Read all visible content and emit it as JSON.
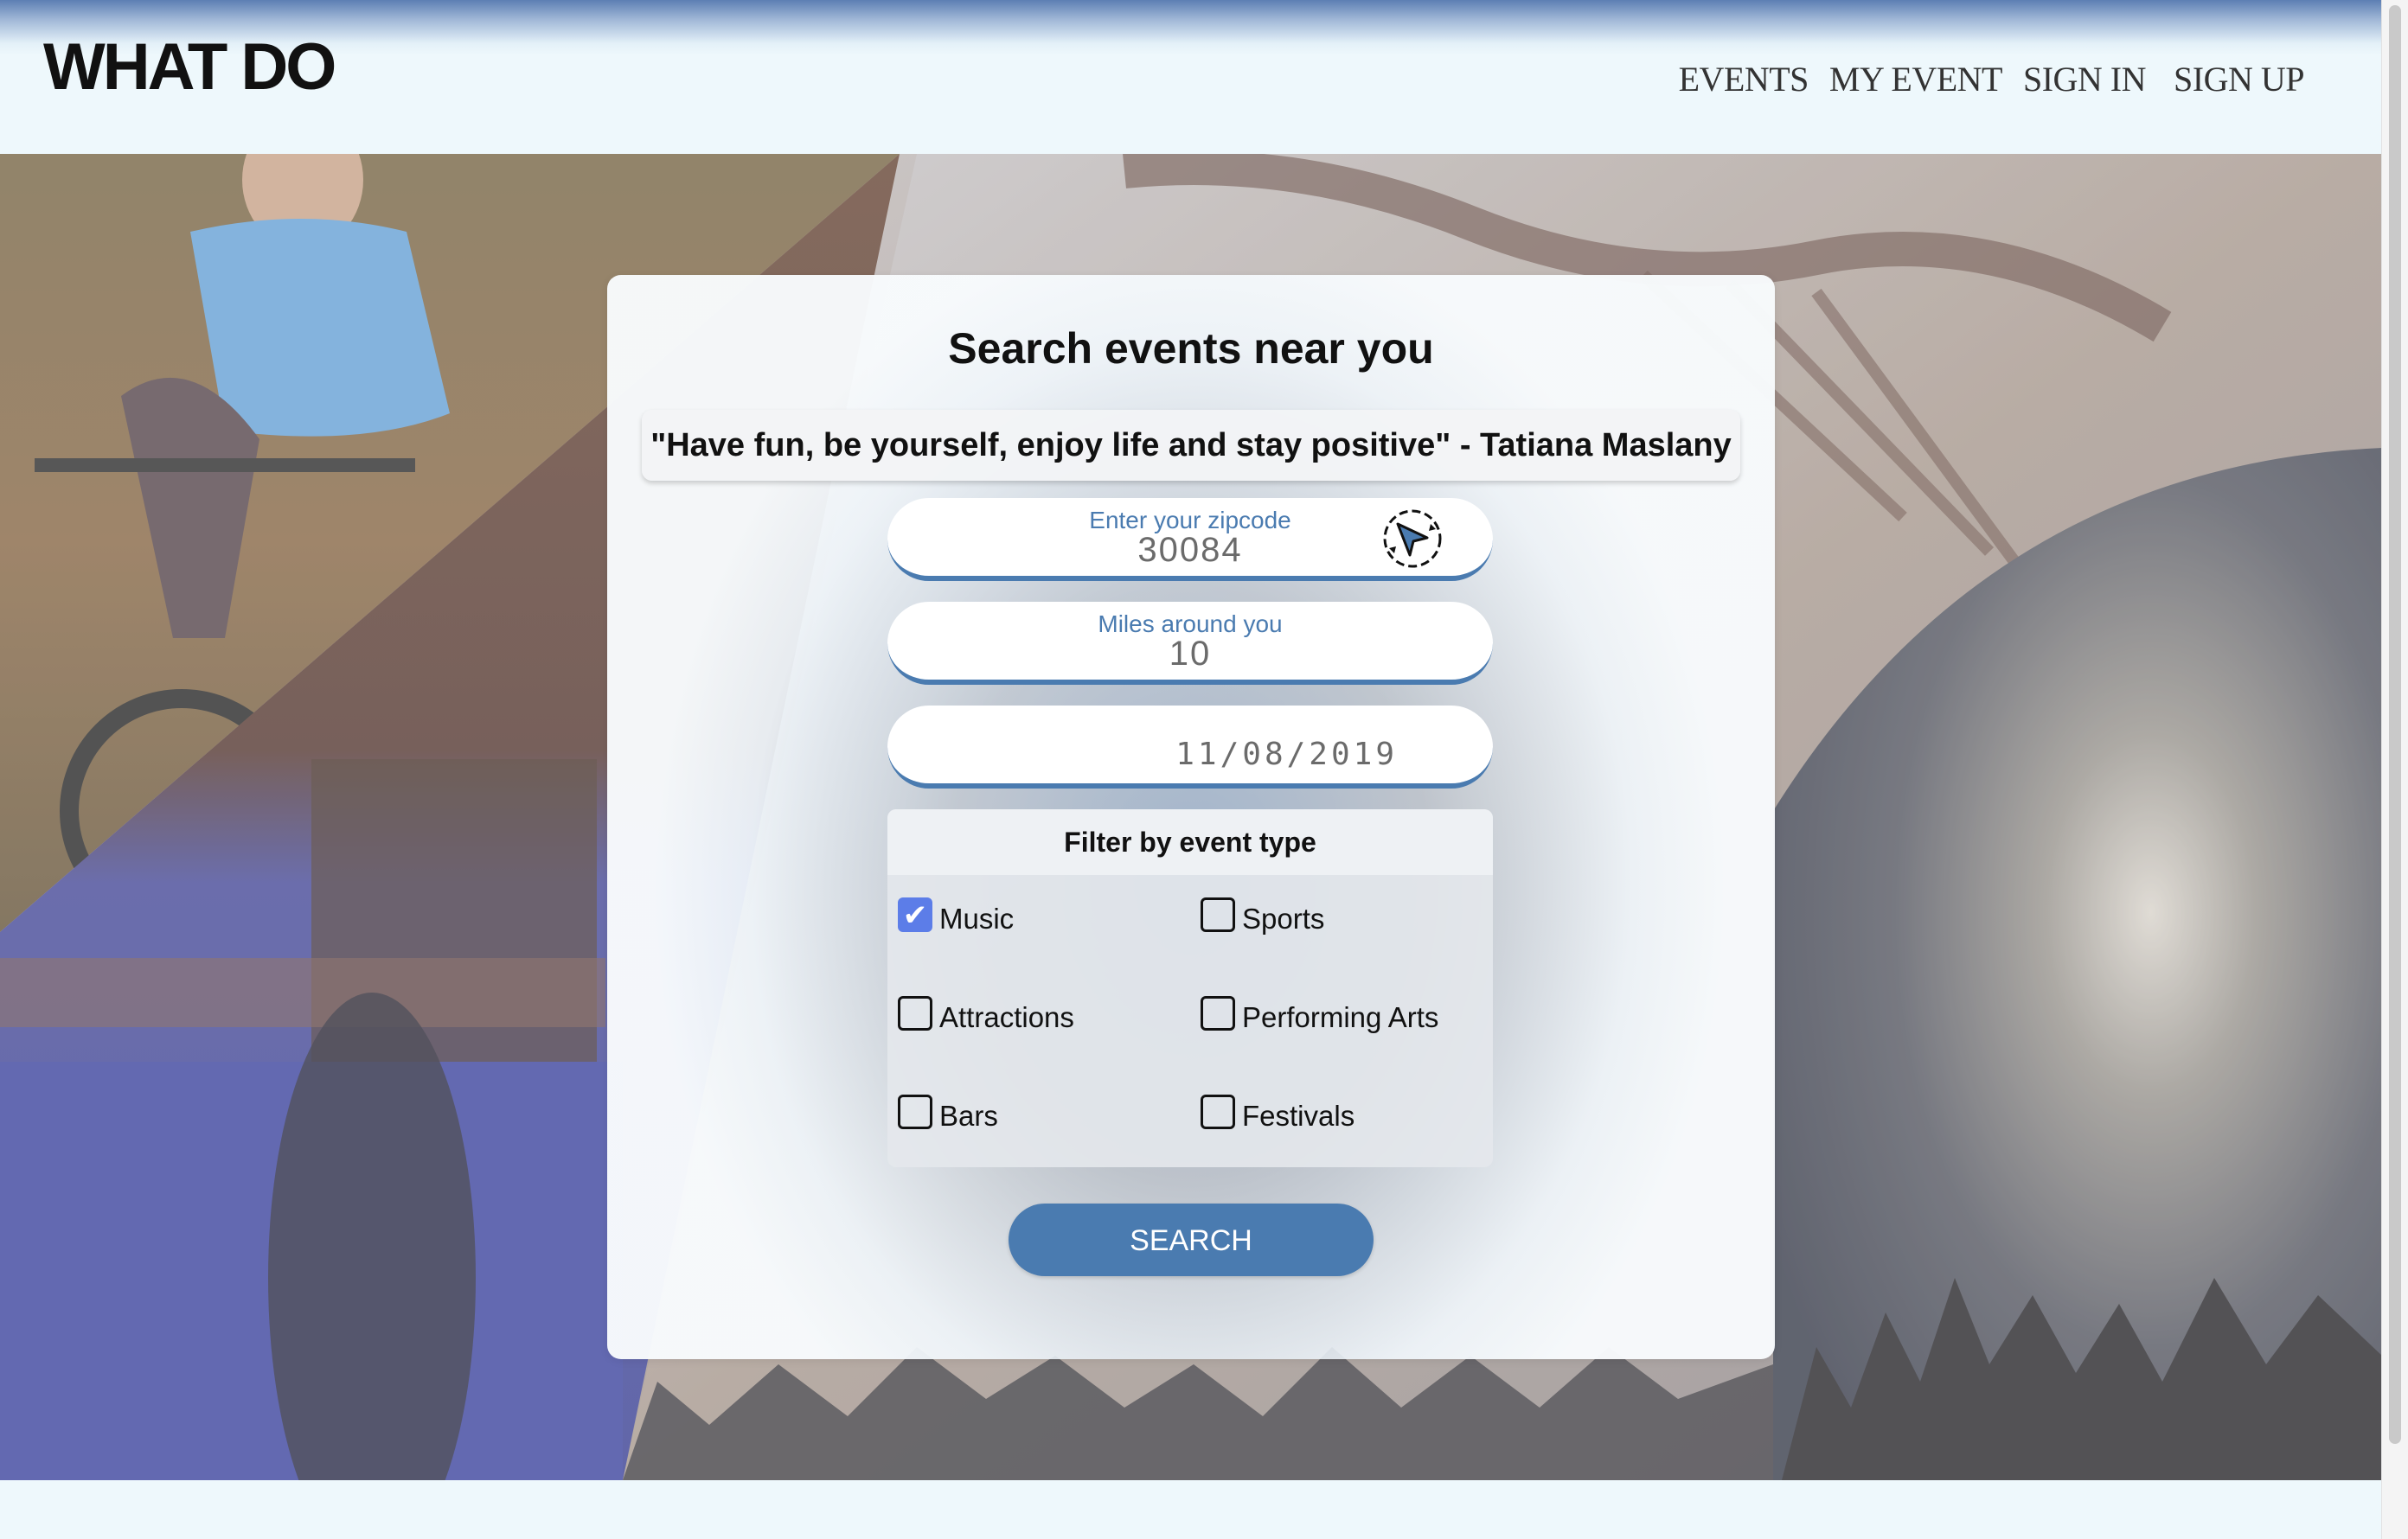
{
  "header": {
    "brand": "WHAT DO",
    "nav": [
      "EVENTS",
      "MY EVENT",
      "SIGN IN",
      "SIGN UP"
    ]
  },
  "search": {
    "title": "Search events near you",
    "quote": "\"Have fun, be yourself, enjoy life and stay positive\" - Tatiana Maslany",
    "zipcode": {
      "label": "Enter your zipcode",
      "value": "30084"
    },
    "miles": {
      "label": "Miles around you",
      "value": "10"
    },
    "date": {
      "value": "11/08/2019"
    },
    "filter": {
      "title": "Filter by event type",
      "options": [
        {
          "label": "Music",
          "checked": true
        },
        {
          "label": "Sports",
          "checked": false
        },
        {
          "label": "Attractions",
          "checked": false
        },
        {
          "label": "Performing Arts",
          "checked": false
        },
        {
          "label": "Bars",
          "checked": false
        },
        {
          "label": "Festivals",
          "checked": false
        }
      ]
    },
    "button": "SEARCH"
  },
  "icons": {
    "locate": "locate-arrow-icon",
    "check": "checkmark-icon"
  },
  "colors": {
    "accent": "#4a7bb0",
    "checkbox_checked": "#5c7de8",
    "header_top": "#5d7fb3",
    "page_bg": "#eef8fc"
  }
}
